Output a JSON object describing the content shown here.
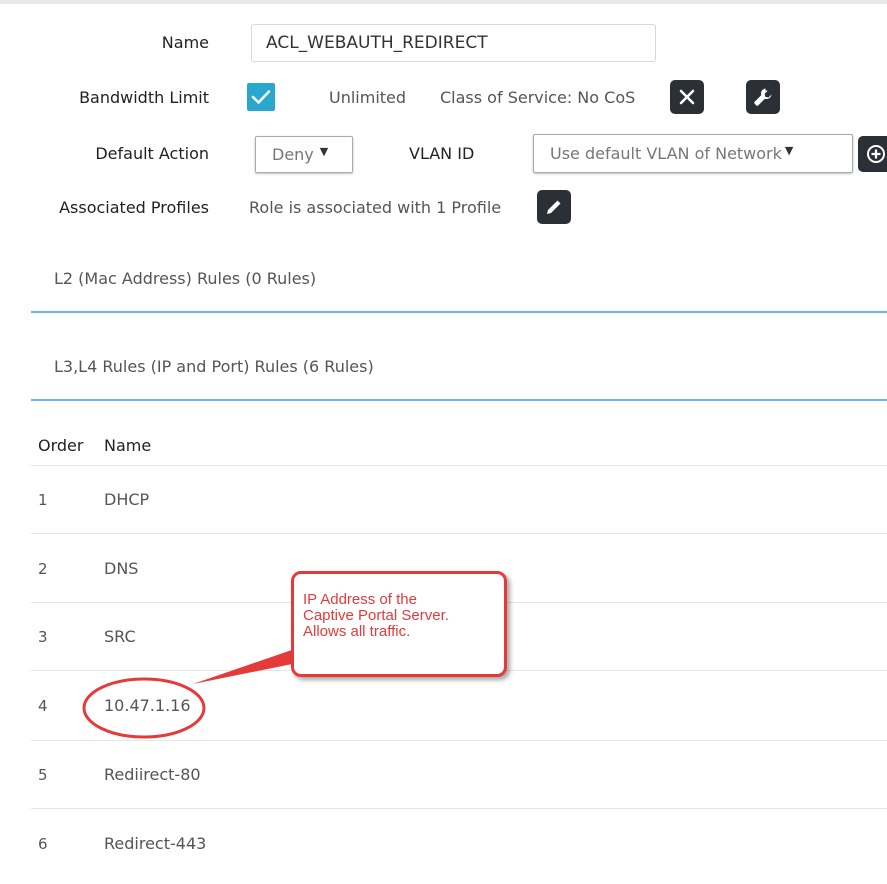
{
  "form": {
    "name_label": "Name",
    "name_value": "ACL_WEBAUTH_REDIRECT",
    "bandwidth_label": "Bandwidth Limit",
    "bandwidth_value": "Unlimited",
    "cos_text": "Class of Service: No CoS",
    "default_action_label": "Default Action",
    "default_action_value": "Deny",
    "vlan_label": "VLAN ID",
    "vlan_value": "Use default VLAN of Network",
    "profiles_label": "Associated Profiles",
    "profiles_text": "Role is associated with 1 Profile"
  },
  "sections": {
    "l2": "L2 (Mac Address) Rules (0 Rules)",
    "l3l4": "L3,L4 Rules (IP and Port) Rules (6 Rules)"
  },
  "table": {
    "headers": [
      "Order",
      "Name"
    ],
    "rows": [
      {
        "order": "1",
        "name": "DHCP"
      },
      {
        "order": "2",
        "name": "DNS"
      },
      {
        "order": "3",
        "name": "SRC"
      },
      {
        "order": "4",
        "name": "10.47.1.16"
      },
      {
        "order": "5",
        "name": "Rediirect-80"
      },
      {
        "order": "6",
        "name": "Redirect-443"
      }
    ]
  },
  "annotation": {
    "lines": [
      "IP Address of the",
      "Captive Portal Server.",
      "Allows all traffic."
    ],
    "color": "#e53a3a"
  },
  "icons": {
    "checkbox": "checkmark-icon",
    "cos_clear": "close-icon",
    "cos_edit": "wrench-icon",
    "vlan_add": "plus-circle-icon",
    "profiles_edit": "pencil-icon"
  },
  "colors": {
    "accent": "#2aa7cc",
    "rule_line": "#6fb7e0",
    "dark_button": "#2b3036"
  }
}
